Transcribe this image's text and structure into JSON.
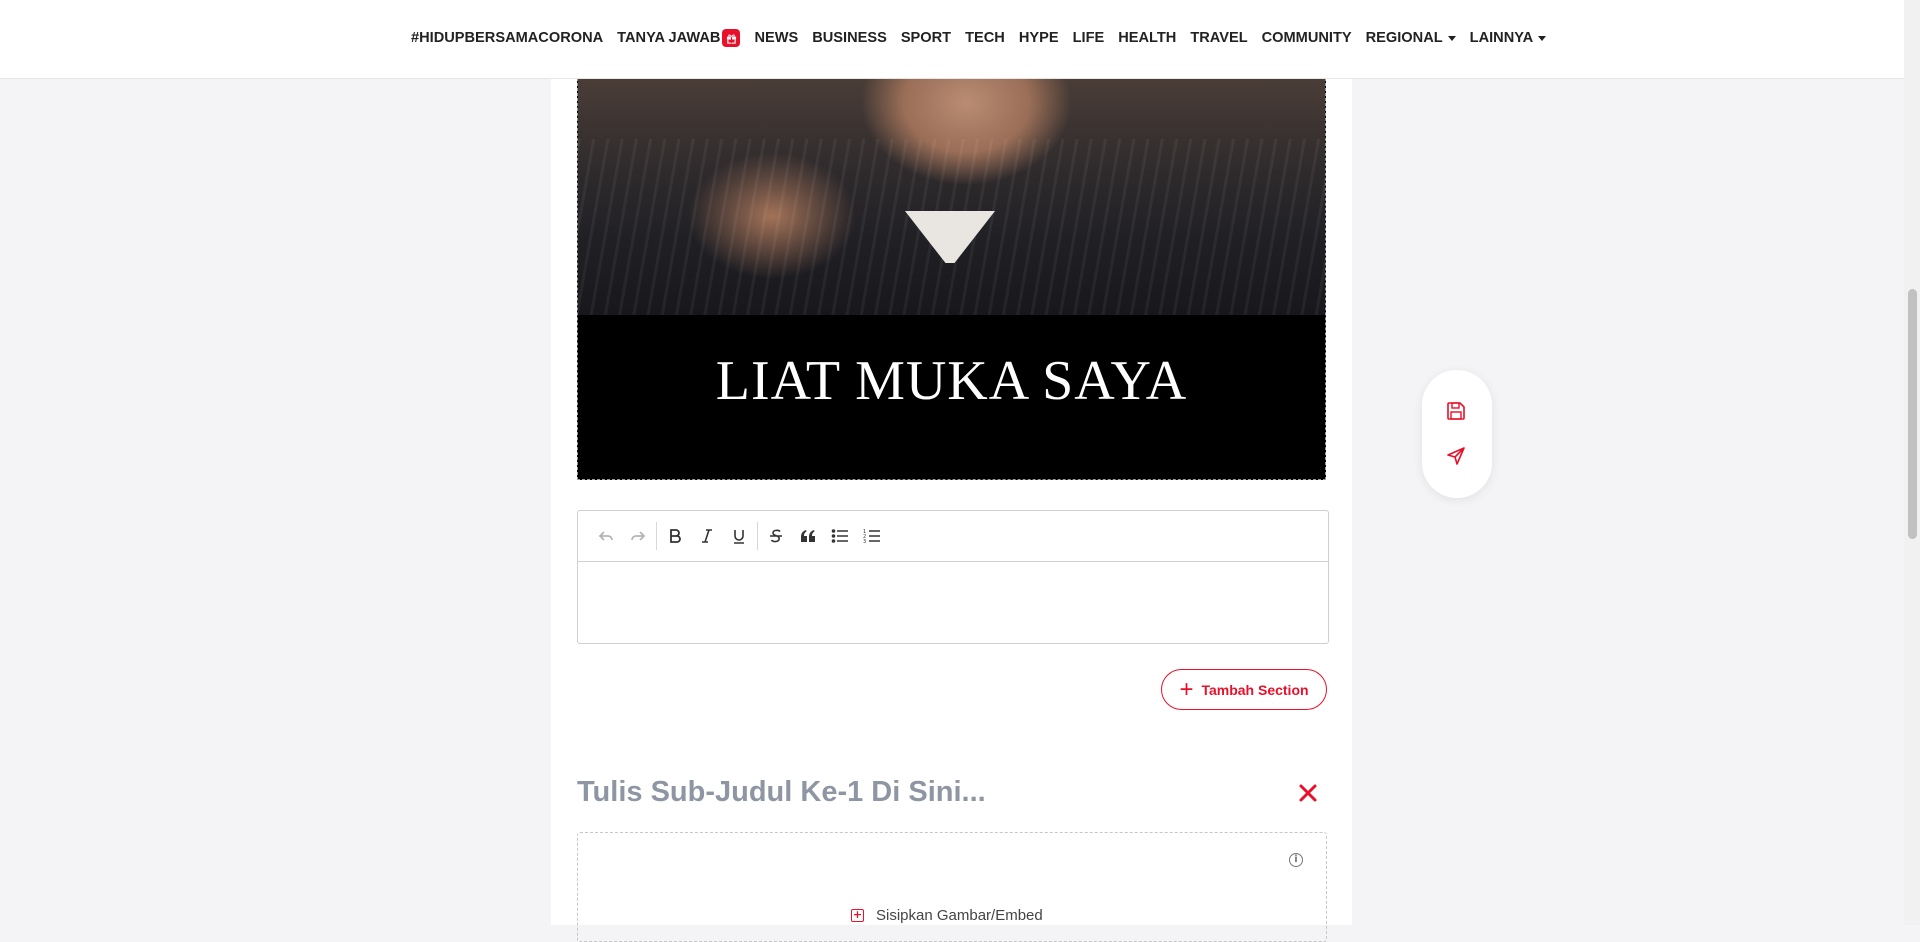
{
  "nav": {
    "items": [
      {
        "label": "#HIDUPBERSAMACORONA"
      },
      {
        "label": "TANYA JAWAB"
      },
      {
        "label": "NEWS"
      },
      {
        "label": "BUSINESS"
      },
      {
        "label": "SPORT"
      },
      {
        "label": "TECH"
      },
      {
        "label": "HYPE"
      },
      {
        "label": "LIFE"
      },
      {
        "label": "HEALTH"
      },
      {
        "label": "TRAVEL"
      },
      {
        "label": "COMMUNITY"
      },
      {
        "label": "REGIONAL"
      },
      {
        "label": "LAINNYA"
      }
    ],
    "badge_icon": "gift-icon"
  },
  "image": {
    "caption": "LIAT MUKA SAYA"
  },
  "editor": {
    "toolbar": [
      "undo-icon",
      "redo-icon",
      "bold-icon",
      "italic-icon",
      "underline-icon",
      "strikethrough-icon",
      "quote-icon",
      "bulleted-list-icon",
      "numbered-list-icon"
    ],
    "content": ""
  },
  "add_section": {
    "label": "Tambah Section"
  },
  "section": {
    "subtitle_placeholder": "Tulis Sub-Judul Ke-1 Di Sini...",
    "embed_label": "Sisipkan Gambar/Embed"
  },
  "floating_actions": [
    "save-icon",
    "send-icon"
  ],
  "colors": {
    "accent": "#e8102a",
    "placeholder": "#8f96a3"
  }
}
